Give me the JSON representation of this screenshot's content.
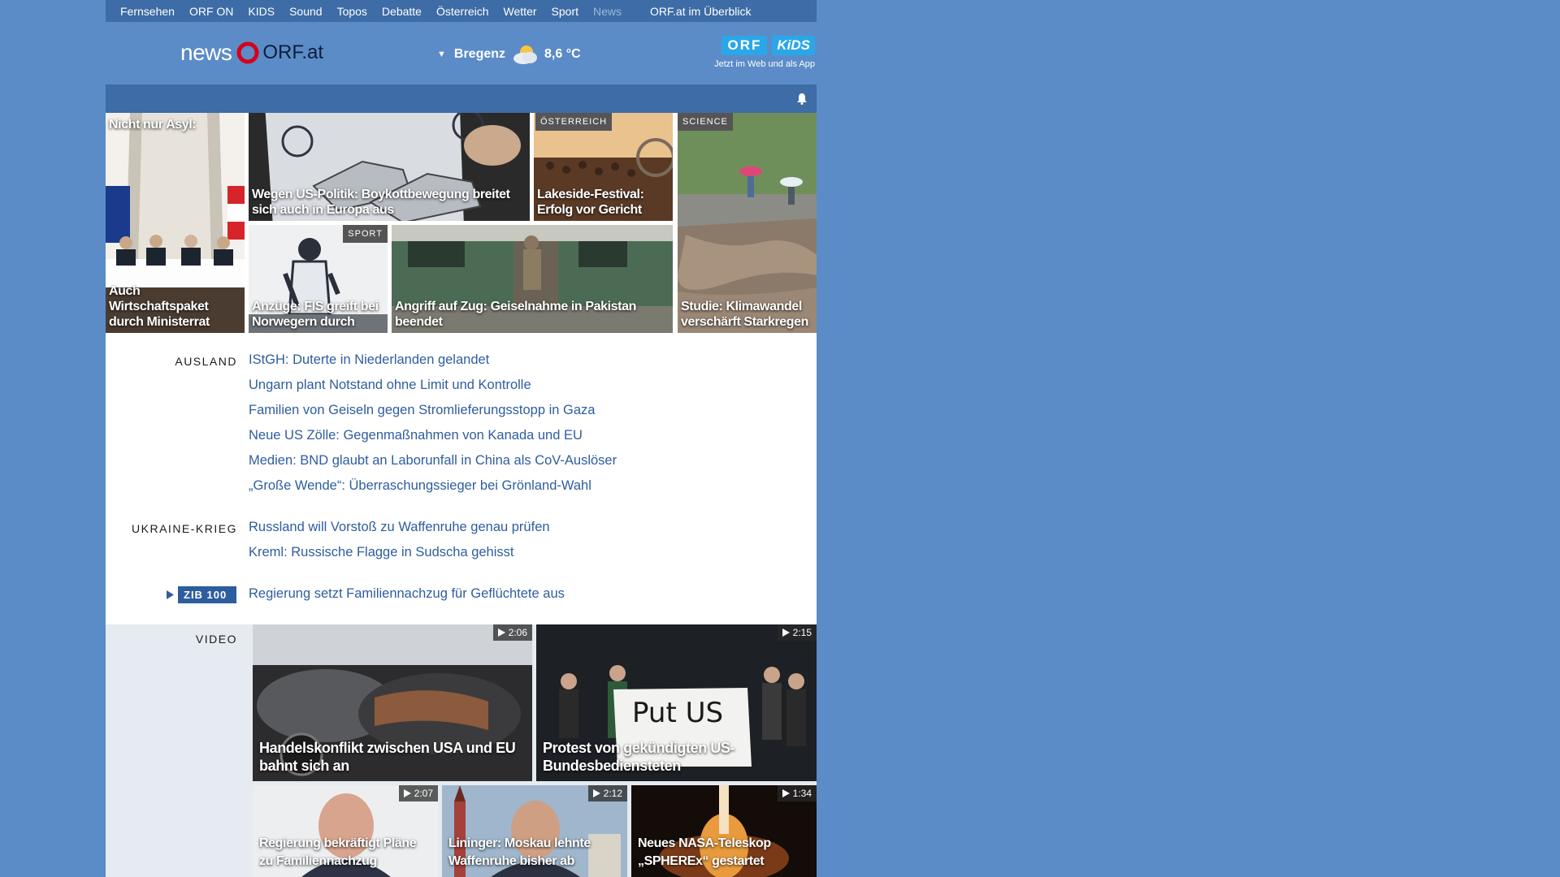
{
  "topnav": {
    "items": [
      "Fernsehen",
      "ORF ON",
      "KIDS",
      "Sound",
      "Topos",
      "Debatte",
      "Österreich",
      "Wetter",
      "Sport",
      "News"
    ],
    "overview": "ORF.at im Überblick",
    "active": "News"
  },
  "header": {
    "logo_news": "news",
    "logo_orf": "ORF.at",
    "weather_city": "Bregenz",
    "weather_temp": "8,6 °C",
    "weather_icon": "partly-cloudy-icon",
    "kids_orf": "ORF",
    "kids_kids": "KiDS",
    "kids_sub": "Jetzt im Web und als App"
  },
  "tiles": [
    {
      "top_caption": "Nicht nur Asyl:",
      "caption": "Auch Wirtschaftspaket durch Ministerrat"
    },
    {
      "caption": "Wegen US-Politik: Boykottbewegung breitet sich auch in Europa aus"
    },
    {
      "tag": "ÖSTERREICH",
      "caption": "Lakeside-Festival: Erfolg vor Gericht"
    },
    {
      "tag": "SCIENCE",
      "caption": "Studie: Klimawandel verschärft Starkregen"
    },
    {
      "tag": "SPORT",
      "caption": "Anzüge: FIS greift bei Norwegern durch"
    },
    {
      "caption": "Angriff auf Zug: Geiselnahme in Pakistan beendet"
    }
  ],
  "sections": {
    "ausland": {
      "label": "AUSLAND",
      "headlines": [
        "IStGH: Duterte in Niederlanden gelandet",
        "Ungarn plant Notstand ohne Limit und Kontrolle",
        "Familien von Geiseln gegen Stromlieferungsstopp in Gaza",
        "Neue US Zölle: Gegenmaßnahmen von Kanada und EU",
        "Medien: BND glaubt an Laborunfall in China als CoV-Auslöser",
        "„Große Wende“: Überraschungssieger bei Grönland-Wahl"
      ]
    },
    "ukraine": {
      "label": "UKRAINE-KRIEG",
      "headlines": [
        "Russland will Vorstoß zu Waffenruhe genau prüfen",
        "Kreml: Russische Flagge in Sudscha gehisst"
      ]
    },
    "zib": {
      "label": "ZIB 100",
      "headline": "Regierung setzt Familiennachzug für Geflüchtete aus"
    }
  },
  "video": {
    "label": "VIDEO",
    "items": [
      {
        "duration": "2:06",
        "caption": "Handelskonflikt zwischen USA und EU bahnt sich an"
      },
      {
        "duration": "2:15",
        "caption": "Protest von gekündigten US-Bundesbediensteten"
      },
      {
        "duration": "2:07",
        "caption": "Regierung bekräftigt Pläne zu Familiennachzug"
      },
      {
        "duration": "2:12",
        "caption": "Lininger: Moskau lehnte Waffenruhe bisher ab"
      },
      {
        "duration": "1:34",
        "caption": "Neues NASA-Teleskop „SPHEREx“ gestartet"
      }
    ]
  },
  "colors": {
    "background": "#5b8cc7",
    "nav": "#3d6ca6",
    "link": "#2e5d9f",
    "orf_red": "#d6001c",
    "kids_blue": "#2aa7e8"
  }
}
